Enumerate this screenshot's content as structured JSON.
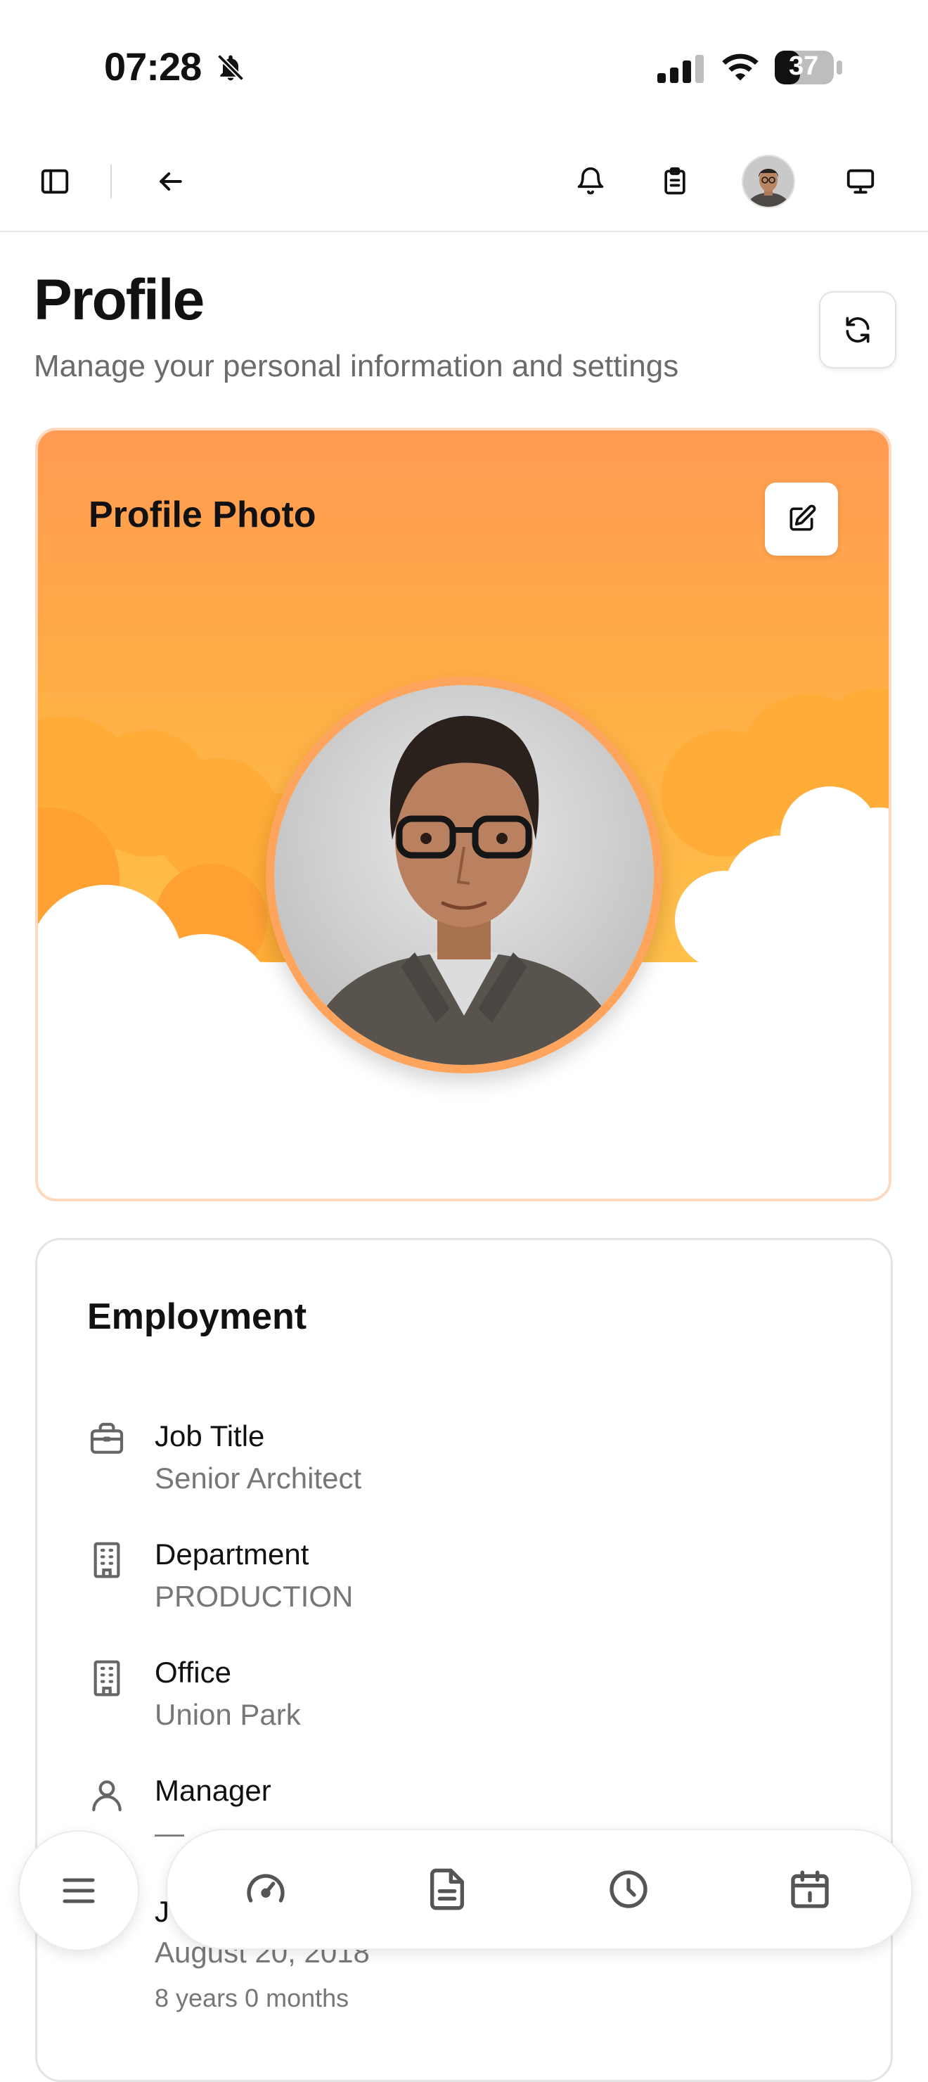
{
  "status_bar": {
    "time": "07:28",
    "battery": "37"
  },
  "header": {
    "title": "Profile",
    "subtitle": "Manage your personal information and settings"
  },
  "profile_card": {
    "title": "Profile Photo"
  },
  "employment": {
    "title": "Employment",
    "fields": [
      {
        "label": "Job Title",
        "value": "Senior Architect",
        "icon": "briefcase-icon"
      },
      {
        "label": "Department",
        "value": "PRODUCTION",
        "icon": "building-icon"
      },
      {
        "label": "Office",
        "value": "Union Park",
        "icon": "building-icon"
      },
      {
        "label": "Manager",
        "value": "—",
        "icon": "user-icon"
      },
      {
        "label": "J",
        "value": "August 20, 2018",
        "sub": "8 years 0 months",
        "icon": "calendar-icon"
      }
    ]
  },
  "colors": {
    "accent": "#ff9a4d",
    "card_border": "#ffd9bd",
    "text_muted": "#6b6b6b"
  },
  "icons": {
    "toolbar": [
      "sidebar-toggle-icon",
      "back-arrow-icon",
      "bell-icon",
      "clipboard-icon",
      "avatar",
      "monitor-icon"
    ],
    "bottom_nav": [
      "menu-icon",
      "dashboard-icon",
      "document-icon",
      "clock-icon",
      "calendar-icon"
    ]
  }
}
